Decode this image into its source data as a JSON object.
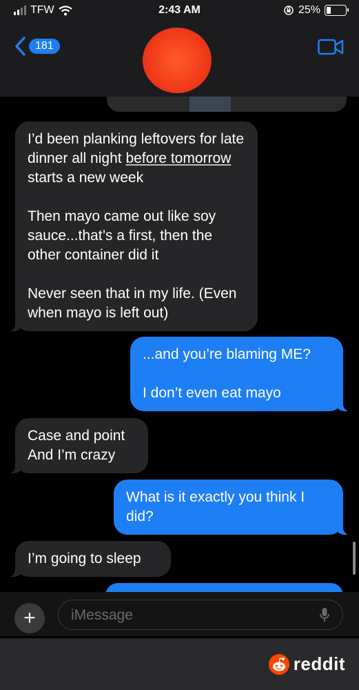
{
  "status": {
    "carrier": "TFW",
    "time": "2:43 AM",
    "battery": "25%",
    "battery_level": 0.25
  },
  "header": {
    "unread_count": "181"
  },
  "messages": [
    {
      "dir": "in",
      "paragraphs": [
        [
          "I’d been planking leftovers for late dinner all night ",
          "before tomorrow",
          " starts a new week"
        ],
        [
          "Then mayo came out like soy sauce...that’s a first, then the other container did it"
        ],
        [
          "Never seen that in my life. (Even when mayo is left out)"
        ]
      ]
    },
    {
      "dir": "out",
      "paragraphs": [
        [
          "...and you’re blaming ME?"
        ],
        [
          "I don’t even eat mayo"
        ]
      ]
    },
    {
      "dir": "in",
      "paragraphs": [
        [
          "Case and point"
        ],
        [
          "And I’m crazy"
        ]
      ]
    },
    {
      "dir": "out",
      "paragraphs": [
        [
          "What is it exactly you think I did?"
        ]
      ]
    },
    {
      "dir": "in",
      "paragraphs": [
        [
          "I’m going to sleep"
        ]
      ]
    }
  ],
  "input": {
    "placeholder": "iMessage"
  },
  "footer": {
    "brand": "reddit"
  },
  "colors": {
    "outgoing": "#1e7ef4",
    "incoming": "#262629",
    "brand": "#ff4500"
  },
  "icons": [
    "signal-icon",
    "wifi-icon",
    "lock-rotation-icon",
    "battery-icon",
    "back-chevron-icon",
    "video-call-icon",
    "plus-icon",
    "microphone-icon",
    "reddit-logo-icon"
  ]
}
